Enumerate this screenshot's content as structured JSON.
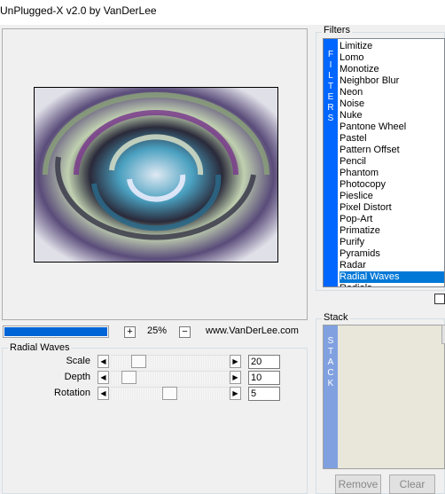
{
  "window": {
    "title": "UnPlugged-X v2.0 by VanDerLee"
  },
  "filters": {
    "label": "Filters",
    "band_letters": [
      "F",
      "I",
      "L",
      "T",
      "E",
      "R",
      "S"
    ],
    "items": [
      "Limitize",
      "Lomo",
      "Monotize",
      "Neighbor Blur",
      "Neon",
      "Noise",
      "Nuke",
      "Pantone Wheel",
      "Pastel",
      "Pattern Offset",
      "Pencil",
      "Phantom",
      "Photocopy",
      "Pieslice",
      "Pixel Distort",
      "Pop-Art",
      "Primatize",
      "Purify",
      "Pyramids",
      "Radar",
      "Radial Waves",
      "Radials"
    ],
    "selected": "Radial Waves"
  },
  "zoom": {
    "plus": "+",
    "value": "25%",
    "minus": "−",
    "site": "www.VanDerLee.com",
    "progress_fraction": 1.0
  },
  "params": {
    "group_label": "Radial Waves",
    "rows": [
      {
        "label": "Scale",
        "value": "20",
        "slider_fraction": 0.2
      },
      {
        "label": "Depth",
        "value": "10",
        "slider_fraction": 0.1
      },
      {
        "label": "Rotation",
        "value": "5",
        "slider_fraction": 0.5
      }
    ]
  },
  "stack": {
    "label": "Stack",
    "band_letters": [
      "S",
      "T",
      "A",
      "C",
      "K"
    ],
    "remove_label": "Remove",
    "clear_label": "Clear"
  },
  "colors": {
    "selection": "#0078d7",
    "band": "#0066ff",
    "stack_band": "#80a0e0"
  }
}
